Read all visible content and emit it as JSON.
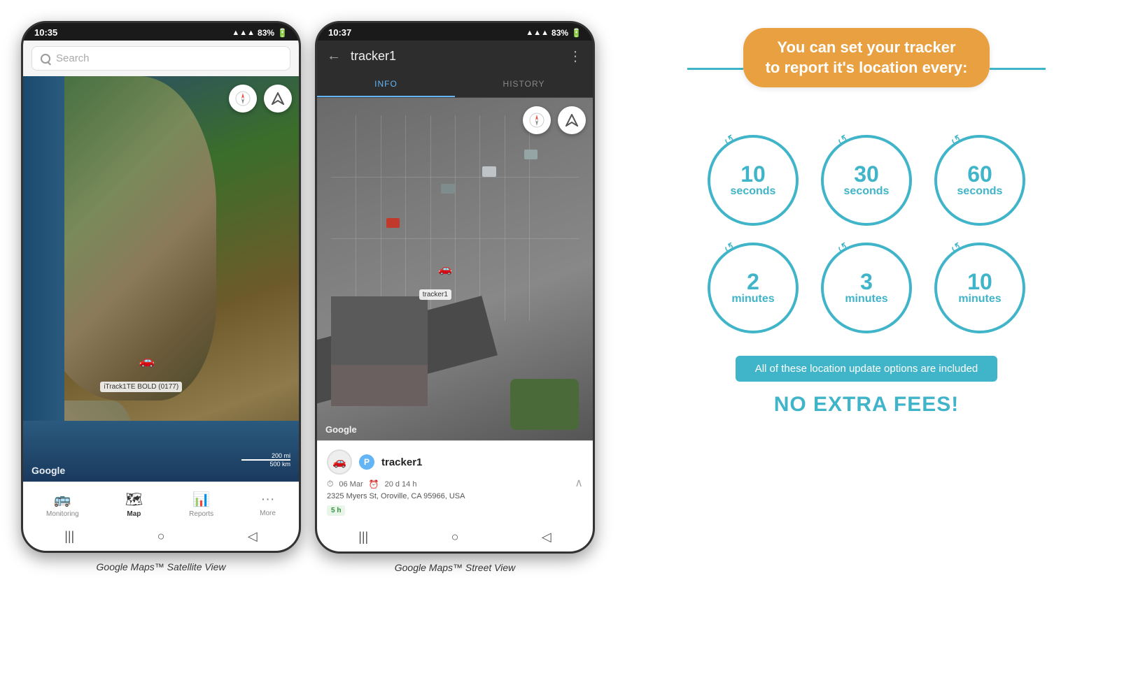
{
  "phone1": {
    "status_bar": {
      "time": "10:35",
      "signal": "▲▲▲",
      "network": ".al",
      "battery": "83%"
    },
    "search": {
      "placeholder": "Search"
    },
    "map": {
      "tracker_label": "iTrack1TE BOLD (0177)",
      "google_watermark": "Google",
      "scale_200mi": "200 mi",
      "scale_500km": "500 km"
    },
    "nav_items": [
      {
        "label": "Monitoring",
        "active": false
      },
      {
        "label": "Map",
        "active": true
      },
      {
        "label": "Reports",
        "active": false
      },
      {
        "label": "More",
        "active": false
      }
    ],
    "caption": "Google Maps™ Satellite View"
  },
  "phone2": {
    "status_bar": {
      "time": "10:37",
      "signal": "▲▲▲",
      "network": ".al",
      "battery": "83%"
    },
    "header": {
      "title": "tracker1",
      "back_arrow": "←",
      "menu": "⋮"
    },
    "tabs": [
      {
        "label": "INFO",
        "active": true
      },
      {
        "label": "HISTORY",
        "active": false
      }
    ],
    "tracker_info": {
      "name": "tracker1",
      "date": "06 Mar",
      "duration": "20 d 14 h",
      "address": "2325 Myers St, Oroville, CA 95966, USA",
      "time_badge": "5 h",
      "tracker_label": "tracker1"
    },
    "caption": "Google Maps™ Street View"
  },
  "info_graphic": {
    "headline": "You can set your tracker\nto report it's location every:",
    "circles": [
      {
        "number": "10",
        "unit": "seconds"
      },
      {
        "number": "30",
        "unit": "seconds"
      },
      {
        "number": "60",
        "unit": "seconds"
      },
      {
        "number": "2",
        "unit": "minutes"
      },
      {
        "number": "3",
        "unit": "minutes"
      },
      {
        "number": "10",
        "unit": "minutes"
      }
    ],
    "included_text": "All of these location update options are included",
    "no_fees_text": "NO EXTRA FEES!"
  }
}
